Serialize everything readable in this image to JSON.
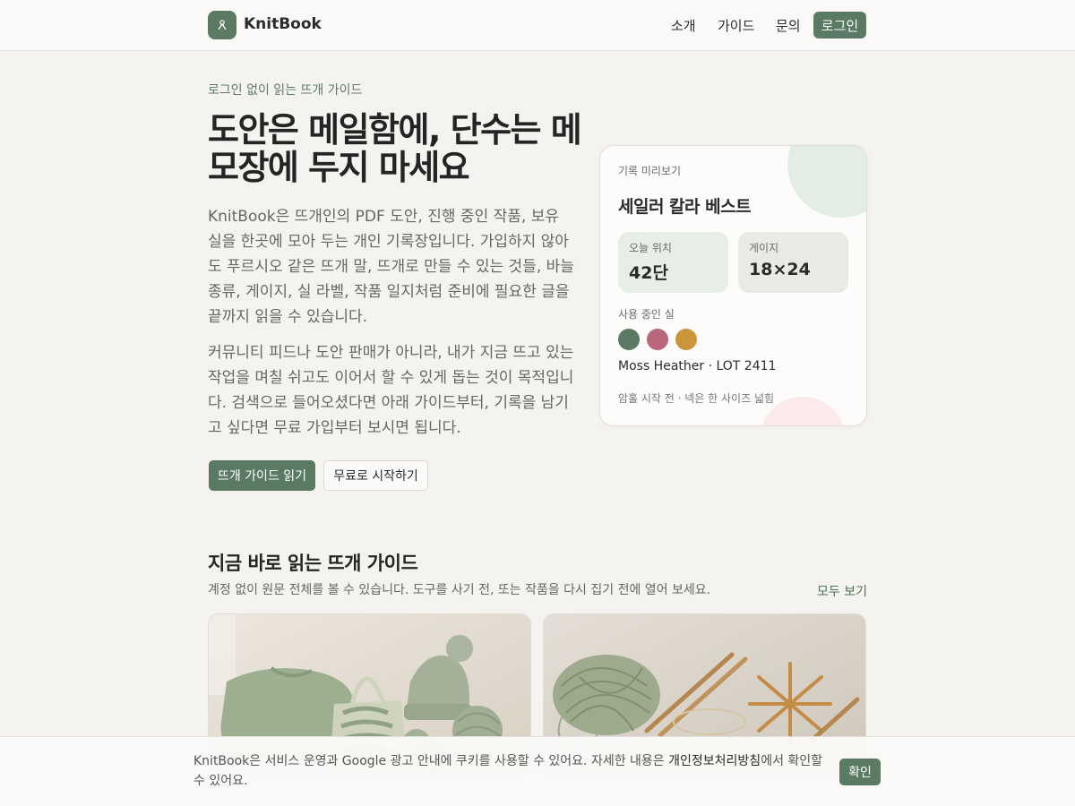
{
  "header": {
    "brand": "KnitBook",
    "logo_icon": "yarn-needle-icon",
    "nav": [
      "소개",
      "가이드",
      "문의"
    ],
    "login": "로그인"
  },
  "hero": {
    "eyebrow": "로그인 없이 읽는 뜨개 가이드",
    "title": "도안은 메일함에, 단수는 메모장에 두지 마세요",
    "paragraph1": "KnitBook은 뜨개인의 PDF 도안, 진행 중인 작품, 보유 실을 한곳에 모아 두는 개인 기록장입니다. 가입하지 않아도 푸르시오 같은 뜨개 말, 뜨개로 만들 수 있는 것들, 바늘 종류, 게이지, 실 라벨, 작품 일지처럼 준비에 필요한 글을 끝까지 읽을 수 있습니다.",
    "paragraph2": "커뮤니티 피드나 도안 판매가 아니라, 내가 지금 뜨고 있는 작업을 며칠 쉬고도 이어서 할 수 있게 돕는 것이 목적입니다. 검색으로 들어오셨다면 아래 가이드부터, 기록을 남기고 싶다면 무료 가입부터 보시면 됩니다.",
    "primary_button": "뜨개 가이드 읽기",
    "secondary_button": "무료로 시작하기"
  },
  "preview_card": {
    "kicker": "기록 미리보기",
    "title": "세일러 칼라 베스트",
    "stats": [
      {
        "label": "오늘 위치",
        "value": "42단",
        "bg": "#e6eee7"
      },
      {
        "label": "게이지",
        "value": "18×24",
        "bg": "#ebe9e5"
      }
    ],
    "yarn_label": "사용 중인 실",
    "swatches": [
      "#5a7a64",
      "#b9677a",
      "#c9963a"
    ],
    "yarn_name": "Moss Heather · LOT 2411",
    "note": "암홀 시작 전 · 넥은 한 사이즈 넓힘"
  },
  "guides": {
    "title": "지금 바로 읽는 뜨개 가이드",
    "subtitle": "계정 없이 원문 전체를 볼 수 있습니다. 도구를 사기 전, 또는 작품을 다시 집기 전에 열어 보세요.",
    "view_all": "모두 보기",
    "cards": [
      {
        "image": "knitted-items-photo"
      },
      {
        "image": "yarn-and-needles-photo"
      }
    ]
  },
  "cookie": {
    "text_before": "KnitBook은 서비스 운영과 Google 광고 안내에 쿠키를 사용할 수 있어요. 자세한 내용은 ",
    "link": "개인정보처리방침",
    "text_after": "에서 확인할 수 있어요.",
    "button": "확인"
  },
  "colors": {
    "accent": "#5a7a64",
    "background": "#f5f3ef"
  }
}
